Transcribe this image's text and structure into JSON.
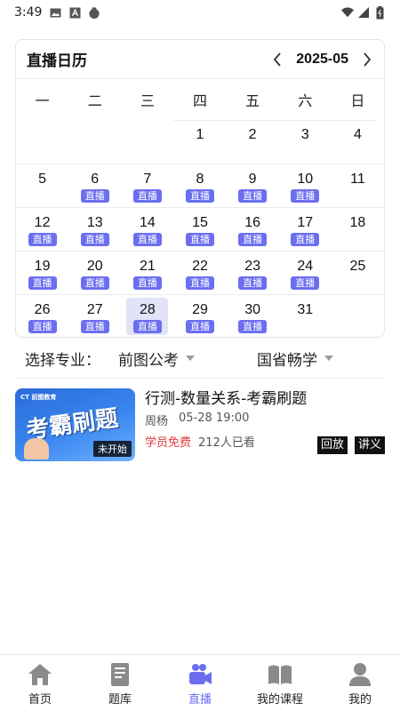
{
  "status_bar": {
    "time": "3:49"
  },
  "calendar": {
    "title": "直播日历",
    "month": "2025-05",
    "weekdays": [
      "一",
      "二",
      "三",
      "四",
      "五",
      "六",
      "日"
    ],
    "live_label": "直播",
    "selected_day": "28",
    "weeks": [
      [
        "",
        "",
        "",
        "1",
        "2",
        "3",
        "4"
      ],
      [
        "5",
        "6",
        "7",
        "8",
        "9",
        "10",
        "11"
      ],
      [
        "12",
        "13",
        "14",
        "15",
        "16",
        "17",
        "18"
      ],
      [
        "19",
        "20",
        "21",
        "22",
        "23",
        "24",
        "25"
      ],
      [
        "26",
        "27",
        "28",
        "29",
        "30",
        "31",
        ""
      ]
    ],
    "live_days": [
      "6",
      "7",
      "8",
      "9",
      "10",
      "12",
      "13",
      "14",
      "15",
      "16",
      "17",
      "19",
      "20",
      "21",
      "22",
      "23",
      "24",
      "26",
      "27",
      "28",
      "29",
      "30"
    ]
  },
  "filter": {
    "label": "选择专业：",
    "primary": "前图公考",
    "secondary": "国省畅学"
  },
  "course": {
    "thumb_brand": "CT 前图教育",
    "thumb_title": "考霸刷题",
    "thumb_status": "未开始",
    "title": "行测-数量关系-考霸刷题",
    "teacher": "周杨",
    "time": "05-28 19:00",
    "price_tag": "学员免费",
    "viewers": "212人已看",
    "replay_label": "回放",
    "notes_label": "讲义"
  },
  "tabs": [
    {
      "label": "首页",
      "icon": "home-icon",
      "active": false
    },
    {
      "label": "题库",
      "icon": "book-icon",
      "active": false
    },
    {
      "label": "直播",
      "icon": "live-icon",
      "active": true
    },
    {
      "label": "我的课程",
      "icon": "open-book-icon",
      "active": false
    },
    {
      "label": "我的",
      "icon": "person-icon",
      "active": false
    }
  ],
  "colors": {
    "accent": "#6b6ef0",
    "selected_bg": "#e2e2f8",
    "free": "#e23b3b"
  }
}
